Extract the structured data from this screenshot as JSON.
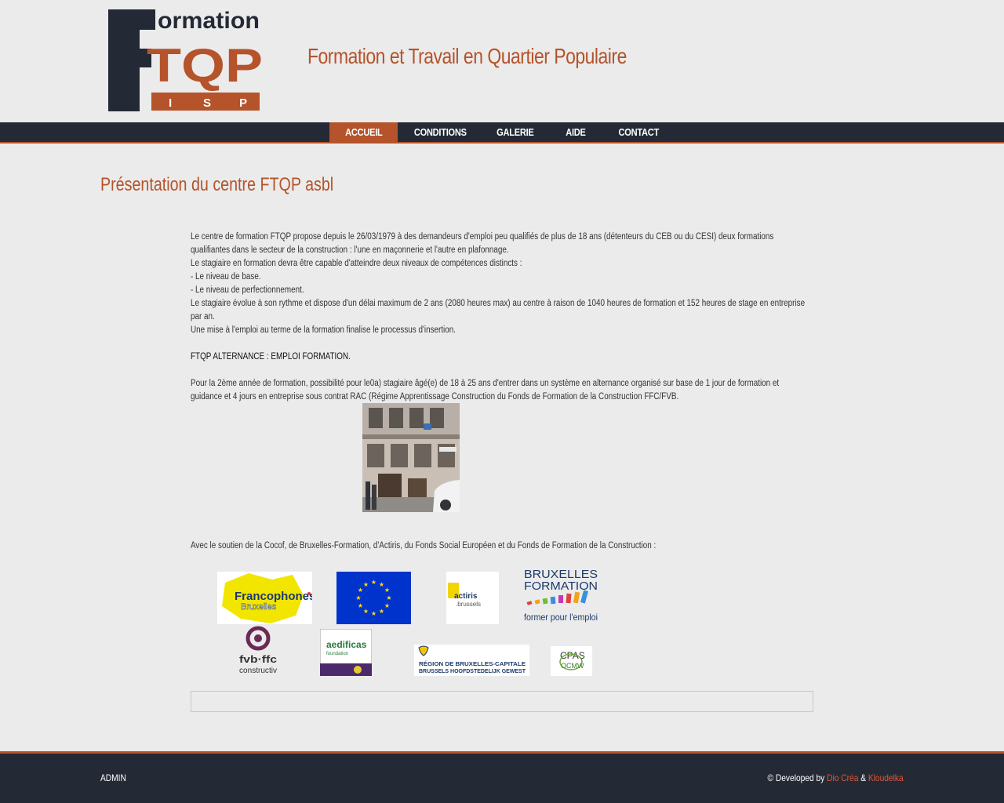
{
  "header": {
    "logo": {
      "word": "ormation",
      "letters": "TQP",
      "sub_letters": [
        "I",
        "S",
        "P"
      ]
    },
    "tagline": "Formation et Travail en Quartier Populaire"
  },
  "nav": {
    "items": [
      {
        "label": "ACCUEIL",
        "active": true
      },
      {
        "label": "CONDITIONS",
        "active": false
      },
      {
        "label": "GALERIE",
        "active": false
      },
      {
        "label": "AIDE",
        "active": false
      },
      {
        "label": "CONTACT",
        "active": false
      }
    ]
  },
  "main": {
    "title": "Présentation du centre FTQP asbl",
    "paragraphs": [
      "Le centre de formation FTQP propose depuis le 26/03/1979 à des demandeurs d'emploi peu qualifiés de plus de 18 ans (détenteurs du CEB ou du CESI) deux formations qualifiantes dans le secteur de la construction : l'une en maçonnerie et l'autre en plafonnage.",
      "Le stagiaire en formation devra être capable d'atteindre deux niveaux de compétences distincts :",
      "- Le niveau de base.",
      "- Le niveau de perfectionnement.",
      "Le stagiaire évolue à son rythme et dispose d'un délai maximum de 2 ans (2080 heures max) au centre à raison de 1040 heures de formation et 152 heures de stage en entreprise par an.",
      "Une mise à l'emploi au terme de la formation finalise le processus d'insertion."
    ],
    "alternance_heading": "FTQP ALTERNANCE : EMPLOI FORMATION.",
    "alternance_text": "Pour la 2ème année de formation, possibilité pour le0a) stagiaire âgé(e) de 18 à 25 ans d'entrer dans un système en alternance organisé sur base de 1 jour de formation et guidance et 4 jours en entreprise sous contrat RAC (Régime Apprentissage Construction du Fonds de Formation de la Construction FFC/FVB.",
    "support_text": "Avec le soutien de la Cocof, de Bruxelles-Formation, d'Actiris, du Fonds Social Européen et du Fonds de Formation de la Construction :",
    "partners": {
      "francophones": {
        "line1": "Francophones",
        "line2": "Bruxelles"
      },
      "actiris": {
        "line1": "actiris",
        "line2": ".brussels"
      },
      "bxl_formation": {
        "line1": "BRUXELLES",
        "line2": "FORMATION",
        "line3": "former pour l'emploi"
      },
      "fvb": {
        "line1": "fvb·ffc",
        "line2": "constructiv"
      },
      "aedificas": {
        "line1": "aedificas",
        "line2": "foundation"
      },
      "region": {
        "line1": "RÉGION DE BRUXELLES-CAPITALE",
        "line2": "BRUSSELS HOOFDSTEDELIJK GEWEST"
      },
      "cpas": {
        "line1": "CPAS",
        "line2": "OCMW"
      }
    }
  },
  "footer": {
    "admin": "ADMIN",
    "developed_prefix": "© Developed by ",
    "dev1": "Dio Créa",
    "amp": " & ",
    "dev2": "Kloudelka"
  },
  "colors": {
    "accent": "#b5532a",
    "navy": "#242a35",
    "background": "#ebebeb"
  }
}
